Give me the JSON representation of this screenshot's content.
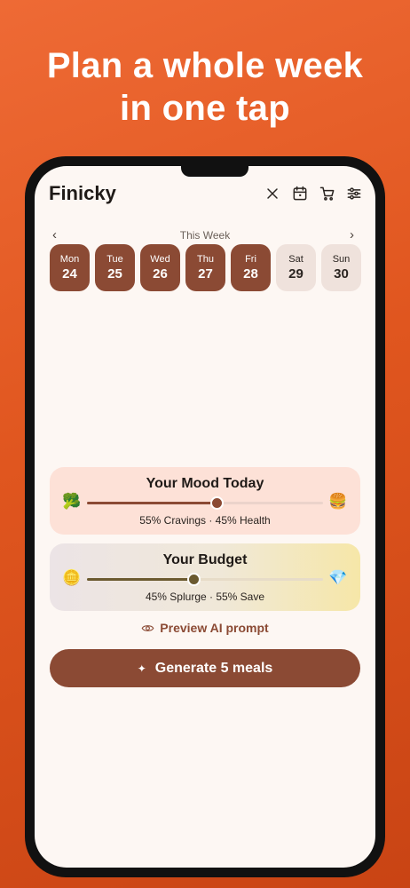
{
  "headline": {
    "line1": "Plan a whole week",
    "line2": "in one tap"
  },
  "app": {
    "title": "Finicky"
  },
  "toolbar": {
    "icons": [
      "close-icon",
      "calendar-icon",
      "cart-icon",
      "sliders-icon"
    ]
  },
  "week": {
    "label": "This Week",
    "prev": "‹",
    "next": "›",
    "days": [
      {
        "name": "Mon",
        "date": "24",
        "selected": true
      },
      {
        "name": "Tue",
        "date": "25",
        "selected": true
      },
      {
        "name": "Wed",
        "date": "26",
        "selected": true
      },
      {
        "name": "Thu",
        "date": "27",
        "selected": true
      },
      {
        "name": "Fri",
        "date": "28",
        "selected": true
      },
      {
        "name": "Sat",
        "date": "29",
        "selected": false
      },
      {
        "name": "Sun",
        "date": "30",
        "selected": false
      }
    ]
  },
  "mood": {
    "title": "Your Mood Today",
    "left_emoji": "🥦",
    "right_emoji": "🍔",
    "value": 0.55,
    "summary": "55% Cravings · 45% Health",
    "color": "#8b4a34"
  },
  "budget": {
    "title": "Your Budget",
    "left_emoji": "🪙",
    "right_emoji": "💎",
    "value": 0.45,
    "summary": "45% Splurge · 55% Save",
    "color": "#6b5a30"
  },
  "preview": {
    "label": "Preview AI prompt"
  },
  "generate": {
    "icon": "✦",
    "label": "Generate 5 meals"
  }
}
